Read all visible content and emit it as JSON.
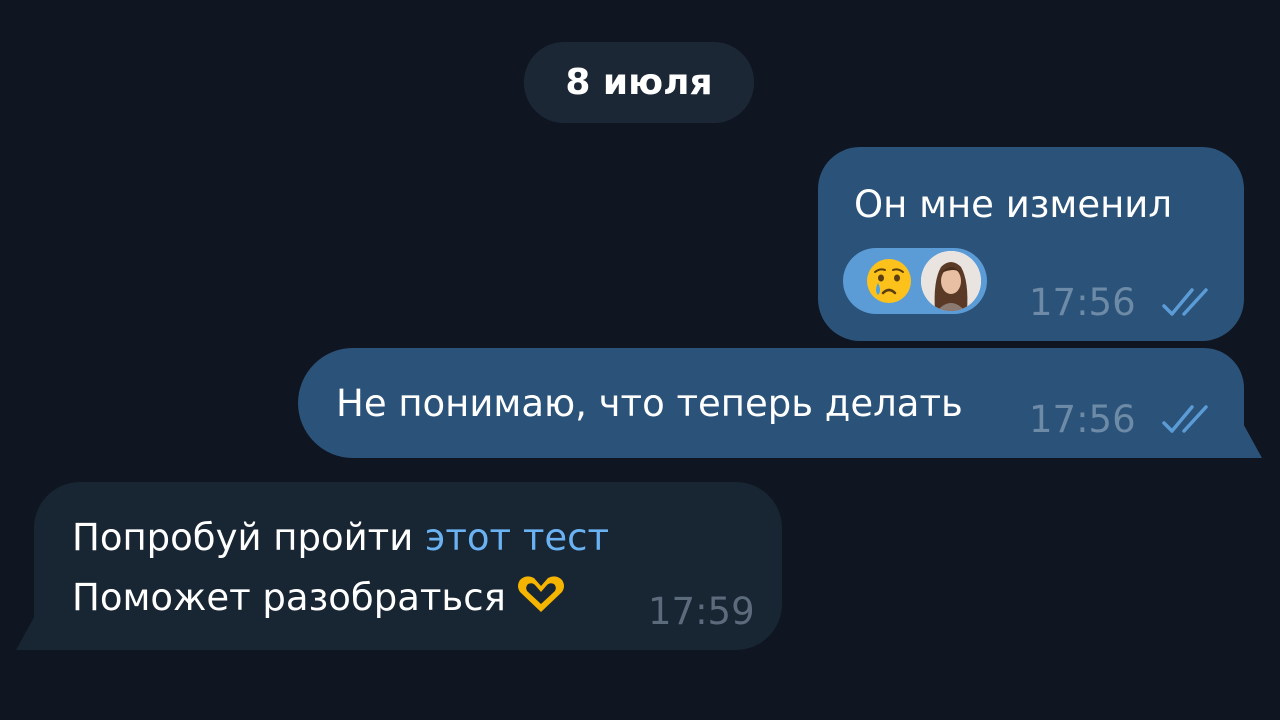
{
  "date_separator": "8 июля",
  "messages": [
    {
      "direction": "outgoing",
      "text": "Он мне изменил",
      "time": "17:56",
      "status": "read",
      "reaction": {
        "emoji": "crying-face",
        "avatar": "user-avatar"
      }
    },
    {
      "direction": "outgoing",
      "text": "Не понимаю, что теперь делать",
      "time": "17:56",
      "status": "read"
    },
    {
      "direction": "incoming",
      "line1_text": "Попробуй пройти ",
      "line1_link": "этот тест",
      "line2_text": "Поможет разобраться",
      "line2_emoji": "heart-hands",
      "time": "17:59"
    }
  ],
  "colors": {
    "background": "#0f1521",
    "outgoing_bubble": "#2b5278",
    "incoming_bubble": "#182533",
    "link": "#6ab2f2",
    "reaction": "#5b9bd6",
    "time_outgoing": "#6d8aa6"
  }
}
